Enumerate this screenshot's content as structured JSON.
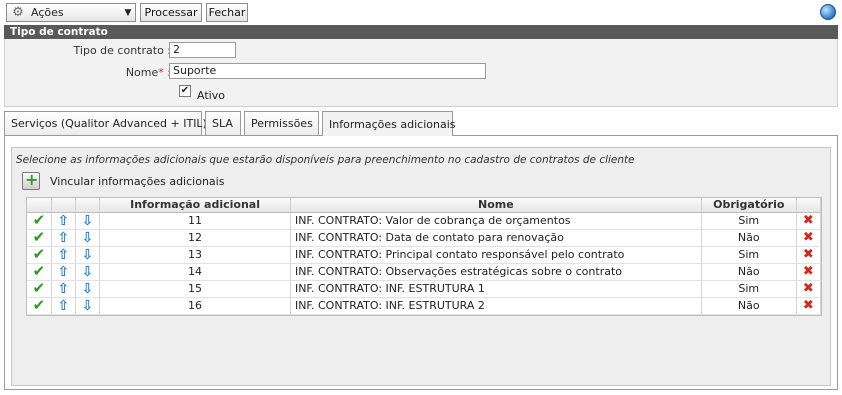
{
  "toolbar": {
    "actions_label": "Ações",
    "process_label": "Processar",
    "close_label": "Fechar"
  },
  "section": {
    "title": "Tipo de contrato",
    "type_label": "Tipo de contrato :",
    "type_value": "2",
    "name_label": "Nome",
    "name_required_mark": "*",
    "name_colon": ":",
    "name_value": "Suporte",
    "active_label": "Ativo",
    "active_checked": true
  },
  "tabs": [
    {
      "label": "Serviços (Qualitor Advanced + ITIL)"
    },
    {
      "label": "SLA"
    },
    {
      "label": "Permissões"
    },
    {
      "label": "Informações adicionais",
      "active": true
    }
  ],
  "content": {
    "description": "Selecione as informações adicionais que estarão disponíveis para preenchimento no cadastro de contratos de cliente",
    "link_label": "Vincular informações adicionais"
  },
  "grid": {
    "headers": [
      "Informação adicional",
      "Nome",
      "Obrigatório"
    ],
    "rows": [
      {
        "id": "11",
        "nome": "INF. CONTRATO: Valor de cobrança de orçamentos",
        "obrigatorio": "Sim"
      },
      {
        "id": "12",
        "nome": "INF. CONTRATO: Data de contato para renovação",
        "obrigatorio": "Não"
      },
      {
        "id": "13",
        "nome": "INF. CONTRATO: Principal contato responsável pelo contrato",
        "obrigatorio": "Sim"
      },
      {
        "id": "14",
        "nome": "INF. CONTRATO: Observações estratégicas sobre o contrato",
        "obrigatorio": "Não"
      },
      {
        "id": "15",
        "nome": "INF. CONTRATO: INF. ESTRUTURA 1",
        "obrigatorio": "Sim"
      },
      {
        "id": "16",
        "nome": "INF. CONTRATO: INF. ESTRUTURA 2",
        "obrigatorio": "Não"
      }
    ]
  }
}
